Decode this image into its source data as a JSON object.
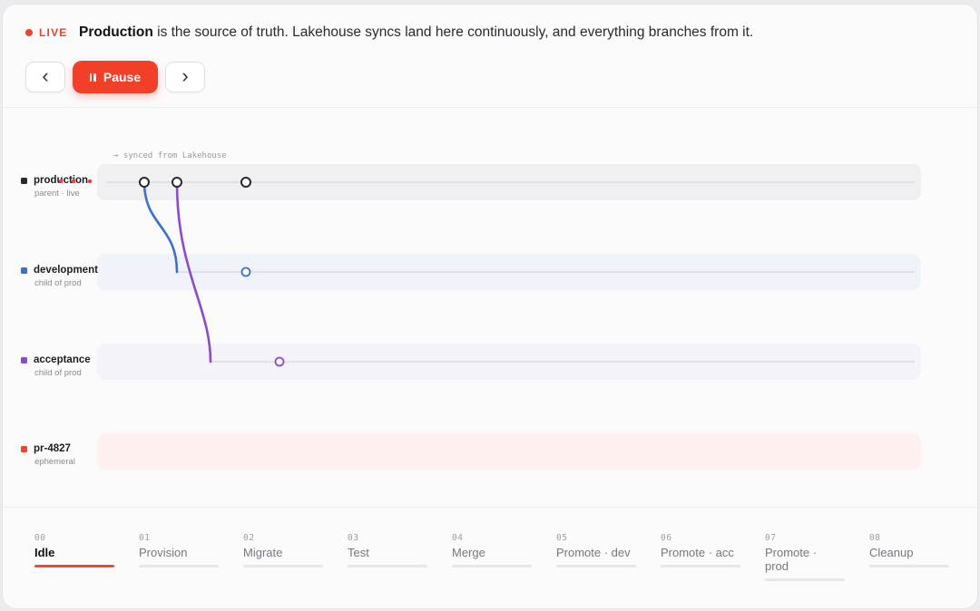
{
  "header": {
    "live_label": "LIVE",
    "headline_bold": "Production",
    "headline_rest": " is the source of truth. Lakehouse syncs land here continuously, and everything branches from it.",
    "prev_icon": "chevron-left-icon",
    "next_icon": "chevron-right-icon",
    "pause_icon": "pause-icon",
    "pause_label": "Pause",
    "prev_glyph": "‹",
    "next_glyph": "›"
  },
  "graph": {
    "synced_note": "→ synced from Lakehouse",
    "branches": [
      {
        "name": "production",
        "subtitle": "parent · live",
        "color": "#2a2a2e"
      },
      {
        "name": "development",
        "subtitle": "child of prod",
        "color": "#3a6fd6"
      },
      {
        "name": "acceptance",
        "subtitle": "child of prod",
        "color": "#8a4ad6"
      },
      {
        "name": "pr-4827",
        "subtitle": "ephemeral",
        "color": "#ee4433"
      }
    ]
  },
  "steps": [
    {
      "num": "00",
      "label": "Idle",
      "active": true
    },
    {
      "num": "01",
      "label": "Provision",
      "active": false
    },
    {
      "num": "02",
      "label": "Migrate",
      "active": false
    },
    {
      "num": "03",
      "label": "Test",
      "active": false
    },
    {
      "num": "04",
      "label": "Merge",
      "active": false
    },
    {
      "num": "05",
      "label": "Promote · dev",
      "active": false
    },
    {
      "num": "06",
      "label": "Promote · acc",
      "active": false
    },
    {
      "num": "07",
      "label": "Promote · prod",
      "active": false
    },
    {
      "num": "08",
      "label": "Cleanup",
      "active": false
    }
  ],
  "colors": {
    "accent": "#f23f27",
    "production": "#2a2a2e",
    "development": "#3a6fd6",
    "acceptance": "#8a4ad6",
    "ephemeral": "#ee4433"
  }
}
